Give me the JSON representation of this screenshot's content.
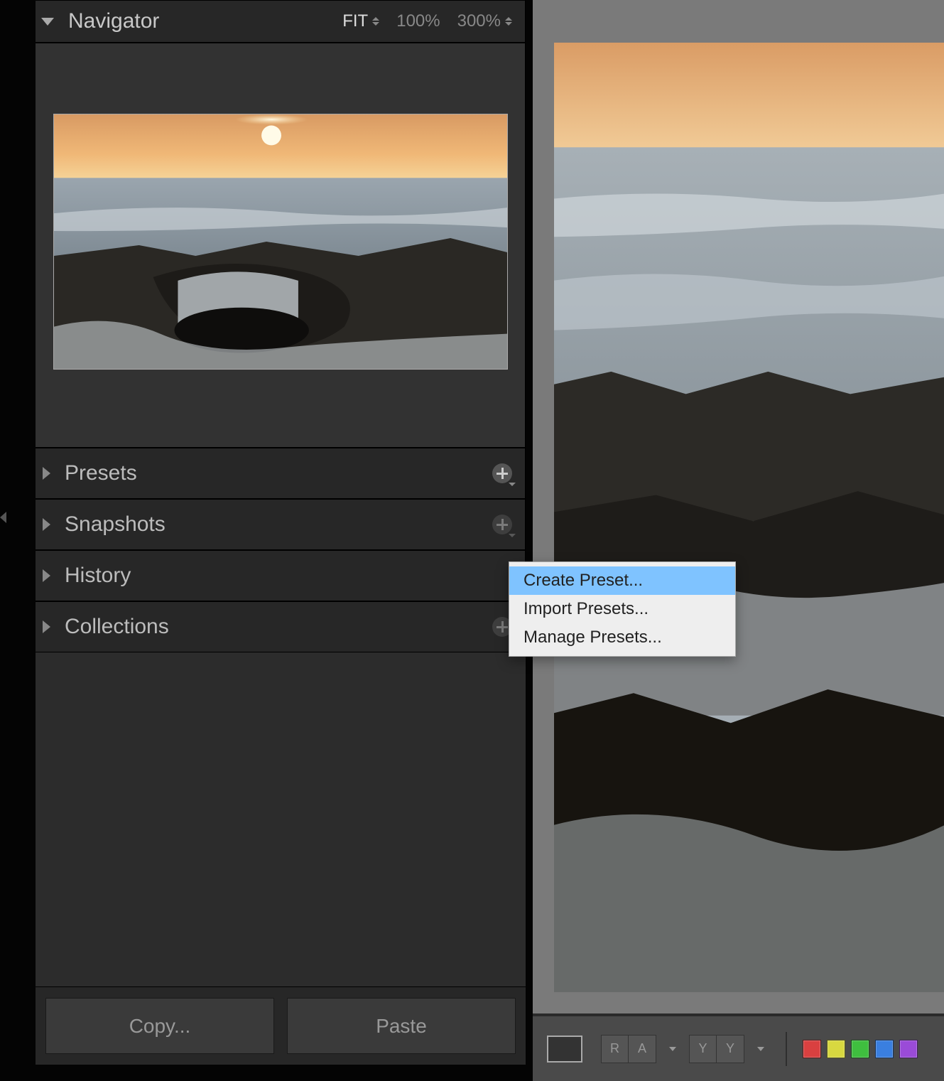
{
  "navigator": {
    "title": "Navigator",
    "zoom_fit": "FIT",
    "zoom_100": "100%",
    "zoom_300": "300%"
  },
  "sections": {
    "presets": "Presets",
    "snapshots": "Snapshots",
    "history": "History",
    "collections": "Collections"
  },
  "buttons": {
    "copy": "Copy...",
    "paste": "Paste"
  },
  "context_menu": {
    "create": "Create Preset...",
    "import": "Import Presets...",
    "manage": "Manage Presets..."
  },
  "toolbar": {
    "seg_r": "R",
    "seg_a": "A",
    "seg_y1": "Y",
    "seg_y2": "Y"
  },
  "colors": {
    "red": "#d94040",
    "yellow": "#d8d840",
    "green": "#3fbf3f",
    "blue": "#3a7fe0",
    "purple": "#9a4bd8"
  }
}
